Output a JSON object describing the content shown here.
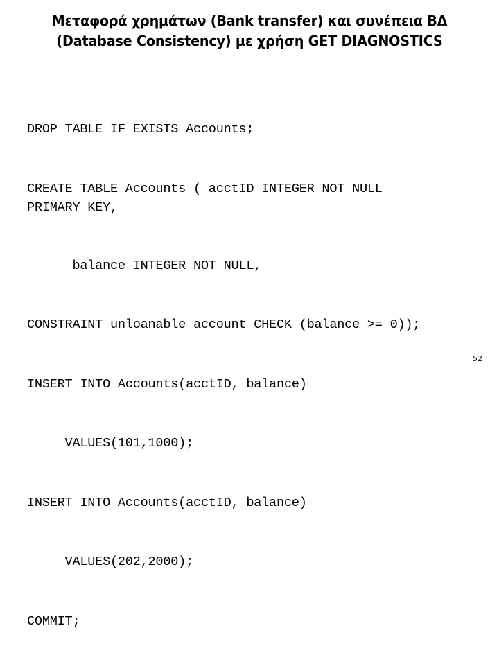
{
  "slide": {
    "title": "Μεταφορά χρημάτων (Bank transfer) και συνέπεια ΒΔ (Database Consistency) με χρήση GET DIAGNOSTICS",
    "page_number": "52",
    "text_color": "#000000",
    "background_color": "#ffffff"
  },
  "code": {
    "language": "sql",
    "lines": [
      "DROP TABLE IF EXISTS Accounts;",
      "CREATE TABLE Accounts ( acctID INTEGER NOT NULL PRIMARY KEY,",
      "      balance INTEGER NOT NULL,",
      "CONSTRAINT unloanable_account CHECK (balance >= 0));",
      "INSERT INTO Accounts(acctID, balance)",
      "     VALUES(101,1000);",
      "INSERT INTO Accounts(acctID, balance)",
      "     VALUES(202,2000);",
      "COMMIT;"
    ]
  }
}
